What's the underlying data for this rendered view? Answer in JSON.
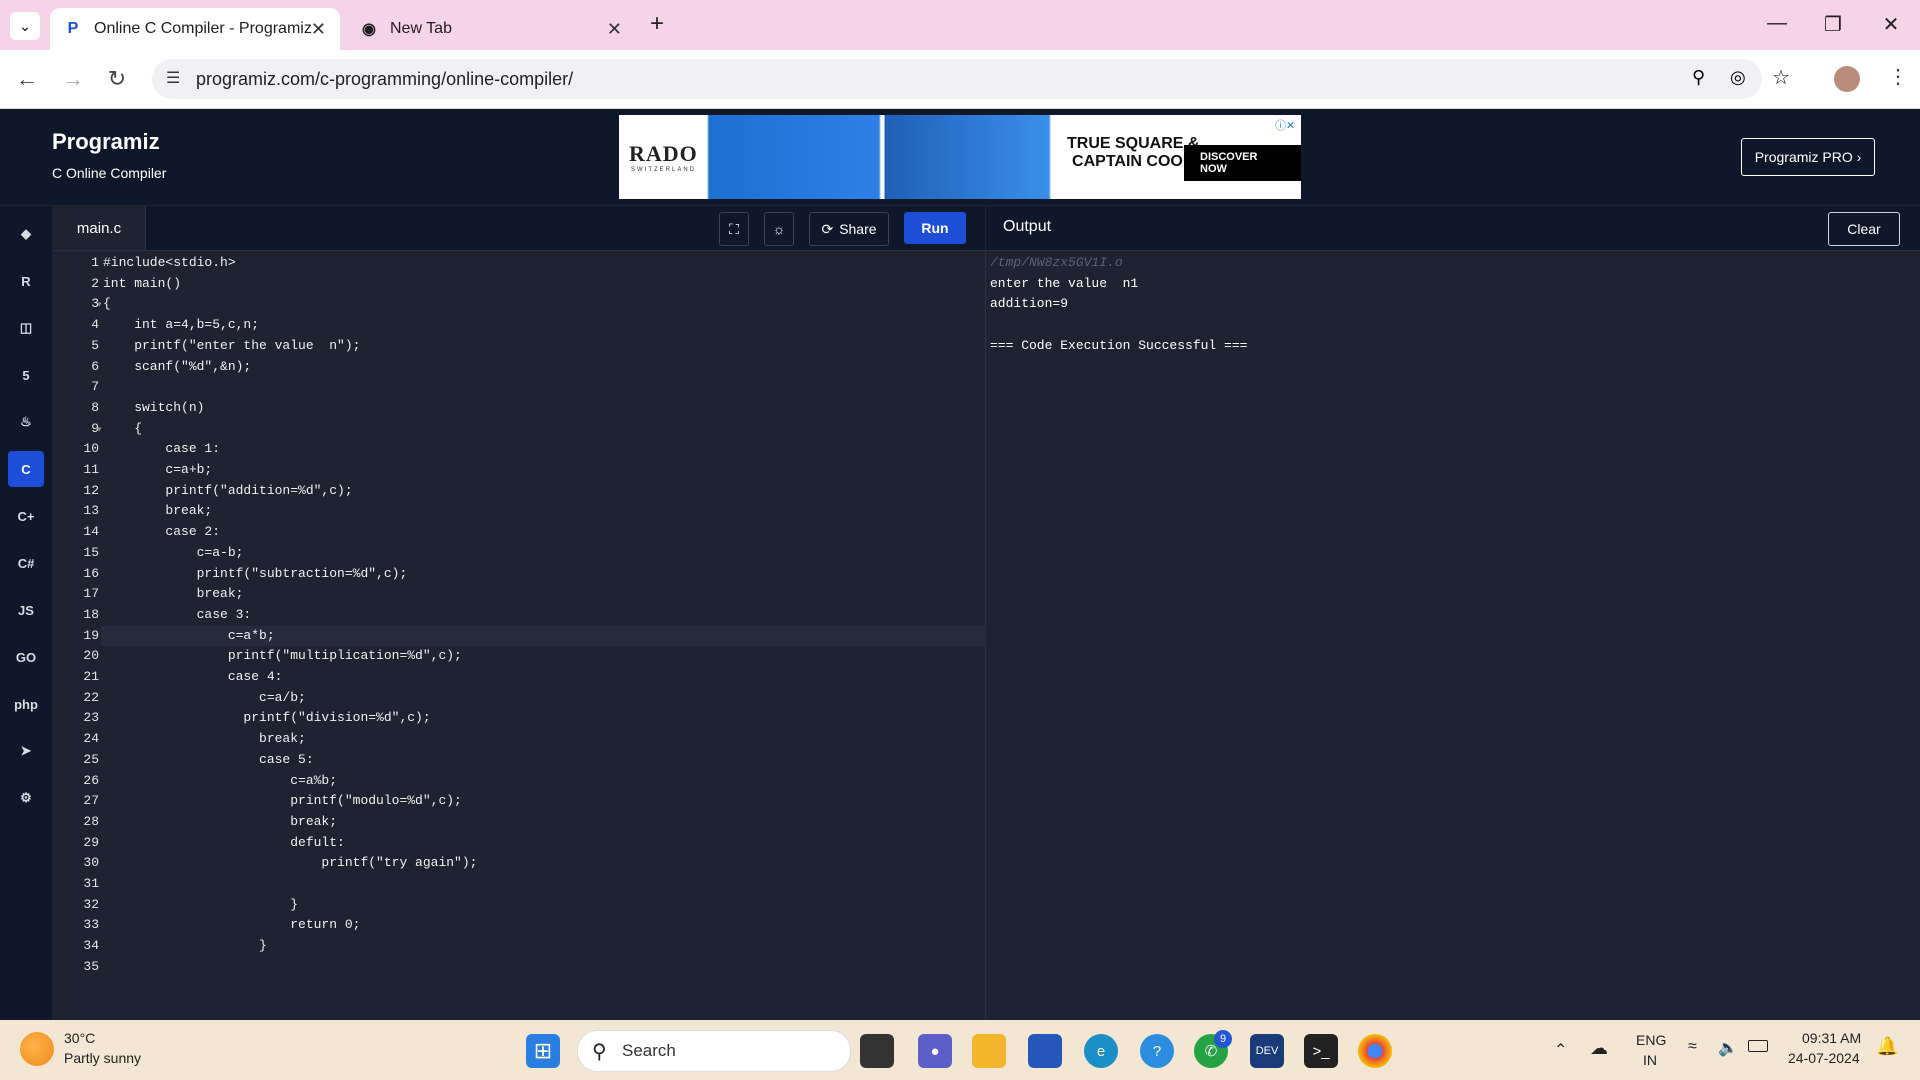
{
  "browser": {
    "tabs": [
      {
        "title": "Online C Compiler - Programiz",
        "favicon": "programiz-p-icon"
      },
      {
        "title": "New Tab",
        "favicon": "chrome-icon"
      }
    ],
    "url": "programiz.com/c-programming/online-compiler/"
  },
  "site": {
    "logo": "Programiz",
    "subtitle": "C Online Compiler",
    "pro_button": "Programiz PRO ›",
    "ad": {
      "brand": "RADO",
      "brand_sub": "SWITZERLAND",
      "headline_1": "TRUE SQUARE &",
      "headline_2": "CAPTAIN COOK",
      "cta": "DISCOVER NOW"
    }
  },
  "languages": [
    "python-icon",
    "r-icon",
    "sql-icon",
    "html-icon",
    "java-icon",
    "c-icon",
    "cpp-icon",
    "csharp-icon",
    "JS",
    "GO",
    "php",
    "swift-icon",
    "rust-icon"
  ],
  "active_language": 5,
  "editor": {
    "filename": "main.c",
    "share_label": "Share",
    "run_label": "Run",
    "active_line": 19,
    "lines": [
      "#include<stdio.h>",
      "int main()",
      "{",
      "    int a=4,b=5,c,n;",
      "    printf(\"enter the value  n\");",
      "    scanf(\"%d\",&n);",
      "",
      "    switch(n)",
      "    {",
      "        case 1:",
      "        c=a+b;",
      "        printf(\"addition=%d\",c);",
      "        break;",
      "        case 2:",
      "            c=a-b;",
      "            printf(\"subtraction=%d\",c);",
      "            break;",
      "            case 3:",
      "                c=a*b;",
      "                printf(\"multiplication=%d\",c);",
      "                case 4:",
      "                    c=a/b;",
      "                  printf(\"division=%d\",c);",
      "                    break;",
      "                    case 5:",
      "                        c=a%b;",
      "                        printf(\"modulo=%d\",c);",
      "                        break;",
      "                        defult:",
      "                            printf(\"try again\");",
      "",
      "                        }",
      "                        return 0;",
      "                    }",
      ""
    ]
  },
  "output": {
    "title": "Output",
    "clear_label": "Clear",
    "lines": [
      "/tmp/NW8zx5GV1I.o",
      "enter the value  n1",
      "addition=9",
      "",
      "=== Code Execution Successful ==="
    ]
  },
  "taskbar": {
    "weather_temp": "30°C",
    "weather_desc": "Partly sunny",
    "search_placeholder": "Search",
    "lang_1": "ENG",
    "lang_2": "IN",
    "time": "09:31 AM",
    "date": "24-07-2024",
    "whatsapp_badge": "9"
  }
}
